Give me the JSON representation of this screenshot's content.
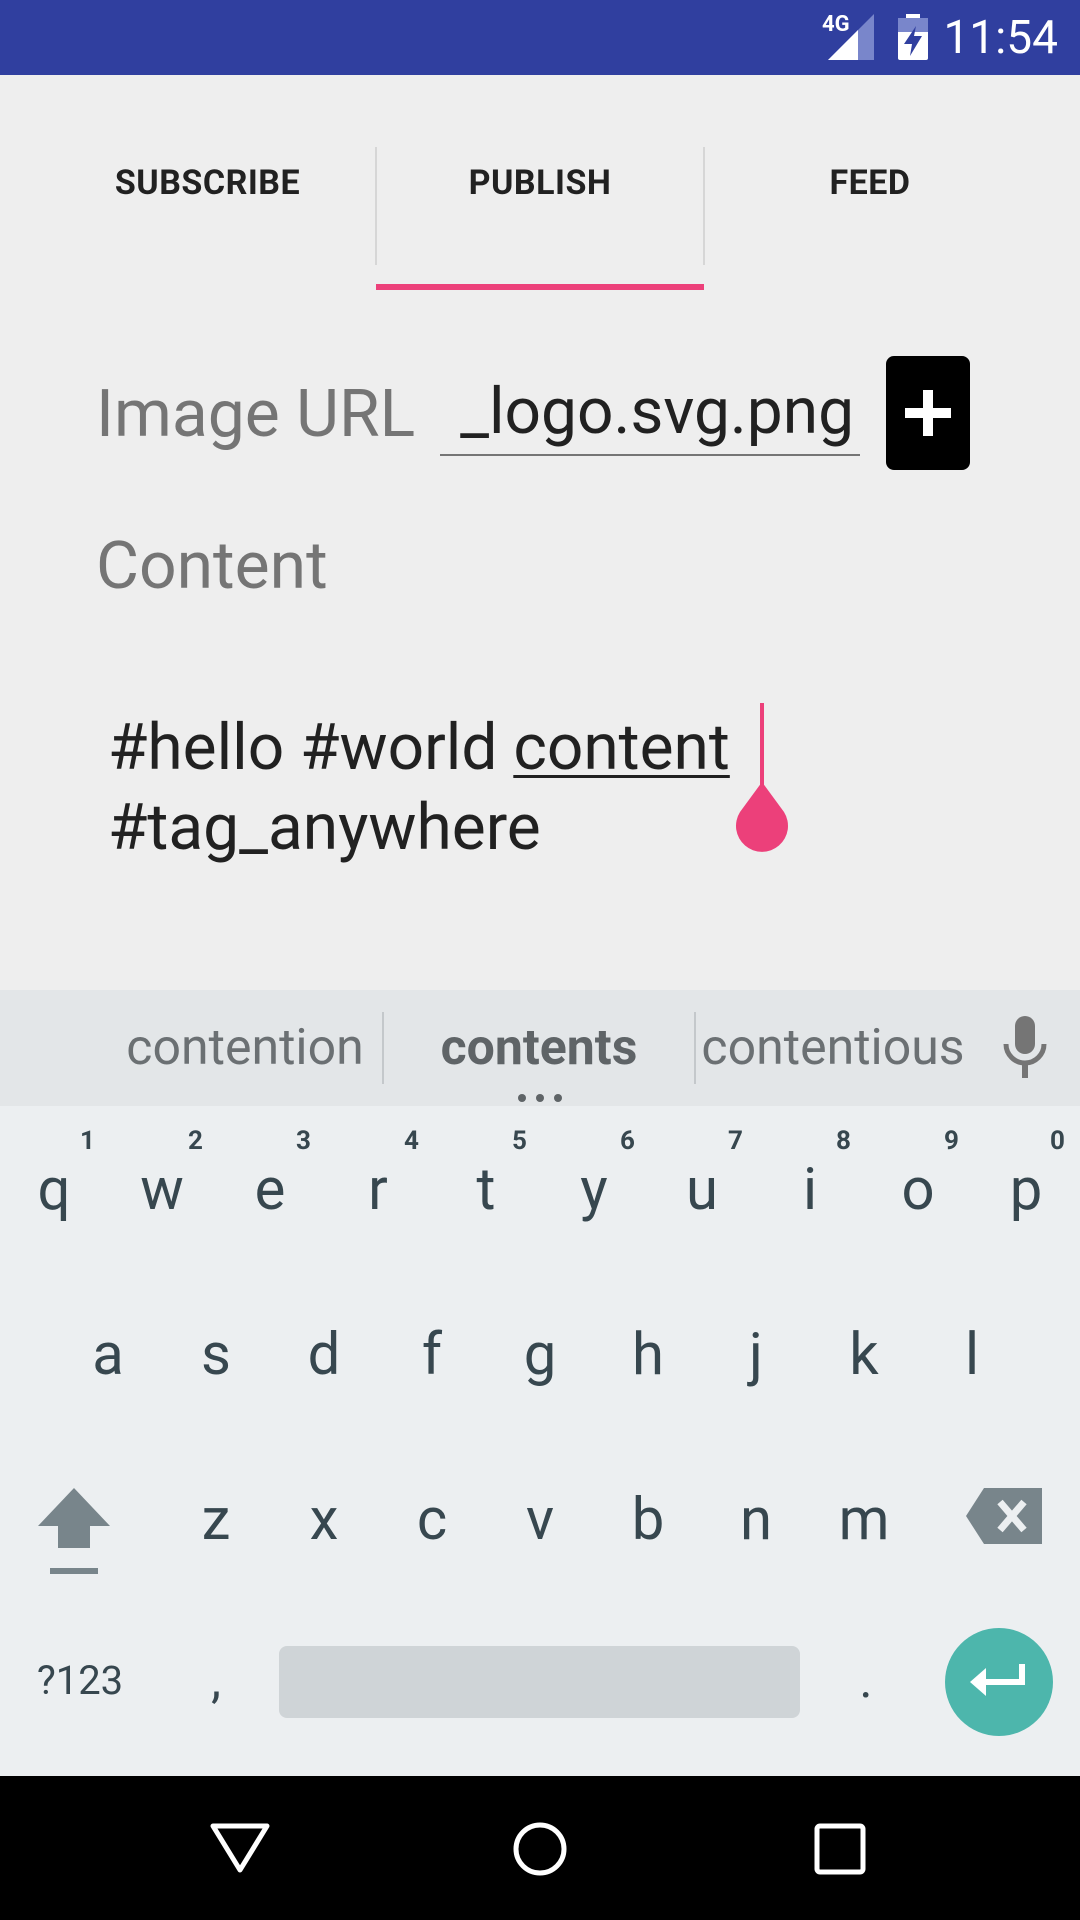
{
  "status_bar": {
    "time": "11:54",
    "network_label": "4G",
    "color": "#303f9f"
  },
  "tabs": [
    {
      "label": "SUBSCRIBE",
      "selected": false
    },
    {
      "label": "PUBLISH",
      "selected": true
    },
    {
      "label": "FEED",
      "selected": false
    }
  ],
  "accent_color": "#ec407a",
  "form": {
    "image_url_label": "Image URL",
    "image_url_value": "_logo.svg.png",
    "add_button_icon": "plus-icon",
    "content_label": "Content",
    "content_line1_prefix": "#hello #world ",
    "content_line1_word": "content",
    "content_line2": "#tag_anywhere"
  },
  "suggestions": {
    "left": "contention",
    "center": "contents",
    "right": "contentious",
    "mic_icon": "mic-icon"
  },
  "keyboard": {
    "row1": [
      {
        "key": "q",
        "hint": "1"
      },
      {
        "key": "w",
        "hint": "2"
      },
      {
        "key": "e",
        "hint": "3"
      },
      {
        "key": "r",
        "hint": "4"
      },
      {
        "key": "t",
        "hint": "5"
      },
      {
        "key": "y",
        "hint": "6"
      },
      {
        "key": "u",
        "hint": "7"
      },
      {
        "key": "i",
        "hint": "8"
      },
      {
        "key": "o",
        "hint": "9"
      },
      {
        "key": "p",
        "hint": "0"
      }
    ],
    "row2": [
      "a",
      "s",
      "d",
      "f",
      "g",
      "h",
      "j",
      "k",
      "l"
    ],
    "row3": [
      "z",
      "x",
      "c",
      "v",
      "b",
      "n",
      "m"
    ],
    "symbols_key": "?123",
    "comma_key": ",",
    "period_key": ".",
    "enter_color": "#4db6ac"
  },
  "nav_bar": {
    "back_icon": "back-triangle-icon",
    "home_icon": "home-circle-icon",
    "recents_icon": "recents-square-icon"
  }
}
